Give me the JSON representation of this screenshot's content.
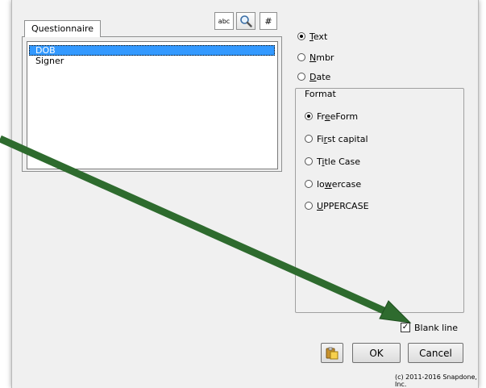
{
  "tabs": [
    {
      "label": "Questionnaire"
    }
  ],
  "toolbar": {
    "abc_label": "abc",
    "hash_label": "#"
  },
  "list": {
    "items": [
      {
        "label": "DOB",
        "selected": true
      },
      {
        "label": "Signer",
        "selected": false
      }
    ]
  },
  "type_options": [
    {
      "pre": "",
      "key": "T",
      "post": "ext",
      "checked": true
    },
    {
      "pre": "",
      "key": "N",
      "post": "mbr",
      "checked": false
    },
    {
      "pre": "",
      "key": "D",
      "post": "ate",
      "checked": false
    }
  ],
  "format": {
    "legend": "Format",
    "options": [
      {
        "pre": "Fr",
        "key": "e",
        "post": "eForm",
        "checked": true
      },
      {
        "pre": "Fi",
        "key": "r",
        "post": "st capital",
        "checked": false
      },
      {
        "pre": "T",
        "key": "i",
        "post": "tle Case",
        "checked": false
      },
      {
        "pre": "lo",
        "key": "w",
        "post": "ercase",
        "checked": false
      },
      {
        "pre": "",
        "key": "U",
        "post": "PPERCASE",
        "checked": false
      }
    ]
  },
  "blank_line": {
    "label": "Blank line",
    "checked": true
  },
  "buttons": {
    "ok": "OK",
    "cancel": "Cancel"
  },
  "copyright": "(c) 2011-2016 Snapdone, Inc.",
  "colors": {
    "selection": "#3399ff",
    "arrow": "#2e6b2e",
    "dialog_bg": "#f0f0f0"
  },
  "icons": {
    "search": "magnifier-icon",
    "paste": "paste-icon",
    "arrow": "arrow-annotation"
  }
}
